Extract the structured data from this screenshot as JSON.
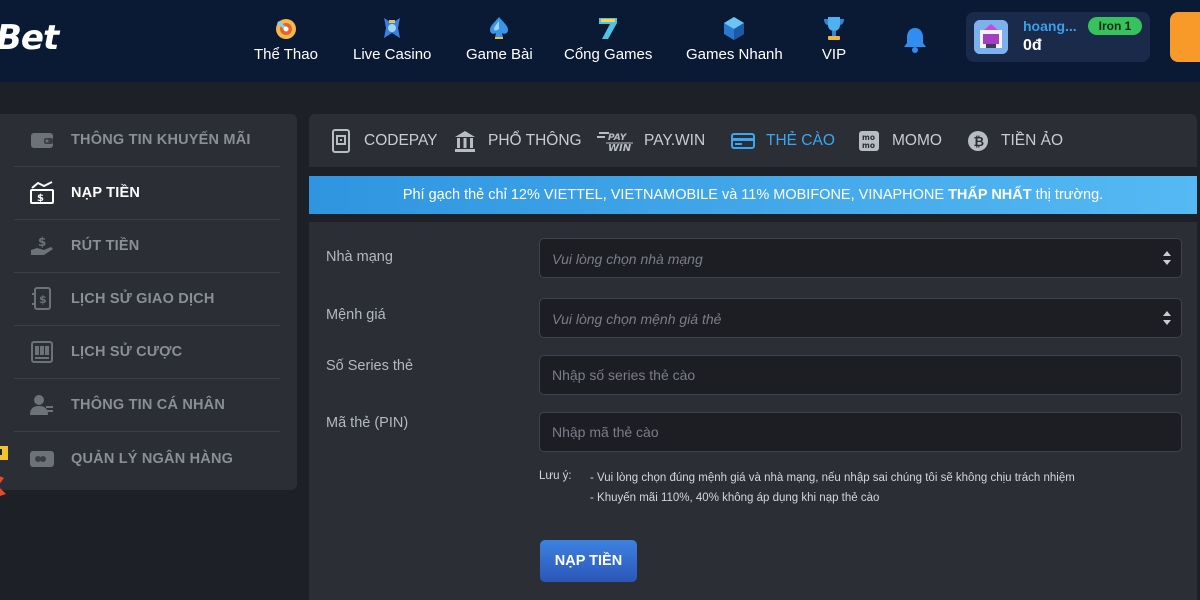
{
  "brand": {
    "logo_text": "Bet"
  },
  "nav": {
    "items": [
      {
        "label": "Thể Thao",
        "icon": "soccer-ball-icon"
      },
      {
        "label": "Live Casino",
        "icon": "casino-dealer-icon"
      },
      {
        "label": "Game Bài",
        "icon": "spade-card-icon"
      },
      {
        "label": "Cổng Games",
        "icon": "lucky-seven-icon"
      },
      {
        "label": "Games Nhanh",
        "icon": "cube-icon"
      },
      {
        "label": "VIP",
        "icon": "trophy-icon"
      }
    ],
    "notification_icon": "bell-icon"
  },
  "user": {
    "name": "hoang...",
    "balance": "0đ",
    "rank": "Iron 1"
  },
  "sidebar": {
    "items": [
      {
        "label": "THÔNG TIN KHUYẾN MÃI",
        "icon": "wallet-icon",
        "active": false
      },
      {
        "label": "NẠP TIỀN",
        "icon": "deposit-cash-icon",
        "active": true
      },
      {
        "label": "RÚT TIỀN",
        "icon": "withdraw-hand-icon",
        "active": false
      },
      {
        "label": "LỊCH SỬ GIAO DỊCH",
        "icon": "transaction-history-icon",
        "active": false
      },
      {
        "label": "LỊCH SỬ CƯỢC",
        "icon": "bet-history-icon",
        "active": false
      },
      {
        "label": "THÔNG TIN CÁ NHÂN",
        "icon": "user-profile-icon",
        "active": false
      },
      {
        "label": "QUẢN LÝ NGÂN HÀNG",
        "icon": "bank-card-icon",
        "active": false
      }
    ]
  },
  "tabs": [
    {
      "label": "CODEPAY",
      "icon": "qr-code-icon",
      "active": false
    },
    {
      "label": "PHỔ THÔNG",
      "icon": "bank-building-icon",
      "active": false
    },
    {
      "label": "PAY.WIN",
      "icon": "paywin-logo-icon",
      "icon_text_top": "PAY",
      "icon_text_bottom": "WIN",
      "active": false
    },
    {
      "label": "THẺ CÀO",
      "icon": "scratch-card-icon",
      "active": true
    },
    {
      "label": "MOMO",
      "icon": "momo-logo-icon",
      "icon_text_top": "mo",
      "icon_text_bottom": "mo",
      "active": false
    },
    {
      "label": "TIỀN ẢO",
      "icon": "bitcoin-icon",
      "active": false
    }
  ],
  "banner": {
    "prefix": "Phí gạch thẻ chỉ 12% VIETTEL, VIETNAMOBILE và 11% MOBIFONE, VINAPHONE",
    "highlight": "THẤP NHẤT",
    "suffix": "thị trường."
  },
  "form": {
    "carrier": {
      "label": "Nhà mạng",
      "placeholder": "Vui lòng chọn nhà mạng"
    },
    "denomination": {
      "label": "Mệnh giá",
      "placeholder": "Vui lòng chọn mệnh giá thẻ"
    },
    "serial": {
      "label": "Số Series thẻ",
      "placeholder": "Nhập số series thẻ cào"
    },
    "pin": {
      "label": "Mã thẻ (PIN)",
      "placeholder": "Nhập mã thẻ cào"
    },
    "note_title": "Lưu ý:",
    "notes": [
      "- Vui lòng chọn đúng mệnh giá và nhà mạng, nếu nhập sai chúng tôi sẽ không chịu trách nhiệm",
      "- Khuyến mãi 110%, 40% không áp dụng khi nạp thẻ cào"
    ],
    "submit_label": "NẠP TIỀN"
  },
  "colors": {
    "topbar": "#0a1a35",
    "accent_blue": "#3aa8f0",
    "rank_green": "#38c25e",
    "orange": "#f79a2a"
  }
}
